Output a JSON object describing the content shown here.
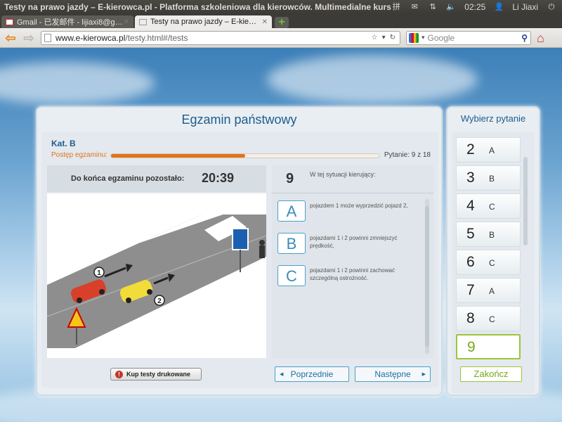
{
  "os": {
    "window_title": "Testy na prawo jazdy – E-kierowca.pl - Platforma szkoleniowa dla kierowców. Multimedialne kursy i tes",
    "clock": "02:25",
    "user": "Li Jiaxi"
  },
  "browser": {
    "tabs": [
      {
        "label": "Gmail - 已发邮件 - lijiaxi8@g…",
        "active": false
      },
      {
        "label": "Testy na prawo jazdy – E-kie…",
        "active": true
      }
    ],
    "url_host": "www.e-kierowca.pl",
    "url_path": "/testy.html#/tests",
    "search_placeholder": "Google"
  },
  "exam": {
    "title": "Egzamin państwowy",
    "category": "Kat. B",
    "progress_label": "Postęp egzaminu:",
    "progress_fraction": 0.5,
    "question_counter": "Pytanie: 9 z 18",
    "timer_label": "Do końca egzaminu pozostało:",
    "timer_value": "20:39",
    "buy_label": "Kup testy drukowane",
    "question_number": "9",
    "question_text": "W tej sytuacji kierujący:",
    "answers": [
      {
        "letter": "A",
        "text": "pojazdem 1 może wyprzedzić pojazd 2,"
      },
      {
        "letter": "B",
        "text": "pojazdami 1 i 2 powinni zmniejszyć prędkość,"
      },
      {
        "letter": "C",
        "text": "pojazdami 1 i 2 powinni zachować szczególną ostrożność."
      }
    ],
    "prev_label": "Poprzednie",
    "next_label": "Następne",
    "scene_labels": {
      "vehicle1": "1",
      "vehicle2": "2"
    }
  },
  "sidebar": {
    "title": "Wybierz pytanie",
    "items": [
      {
        "num": "2",
        "ans": "A"
      },
      {
        "num": "3",
        "ans": "B"
      },
      {
        "num": "4",
        "ans": "C"
      },
      {
        "num": "5",
        "ans": "B"
      },
      {
        "num": "6",
        "ans": "C"
      },
      {
        "num": "7",
        "ans": "A"
      },
      {
        "num": "8",
        "ans": "C"
      },
      {
        "num": "9",
        "ans": ""
      }
    ],
    "finish_label": "Zakończ"
  },
  "colors": {
    "accent_orange": "#e0731c",
    "accent_blue": "#4ba0c8",
    "accent_green": "#9cc63b"
  }
}
